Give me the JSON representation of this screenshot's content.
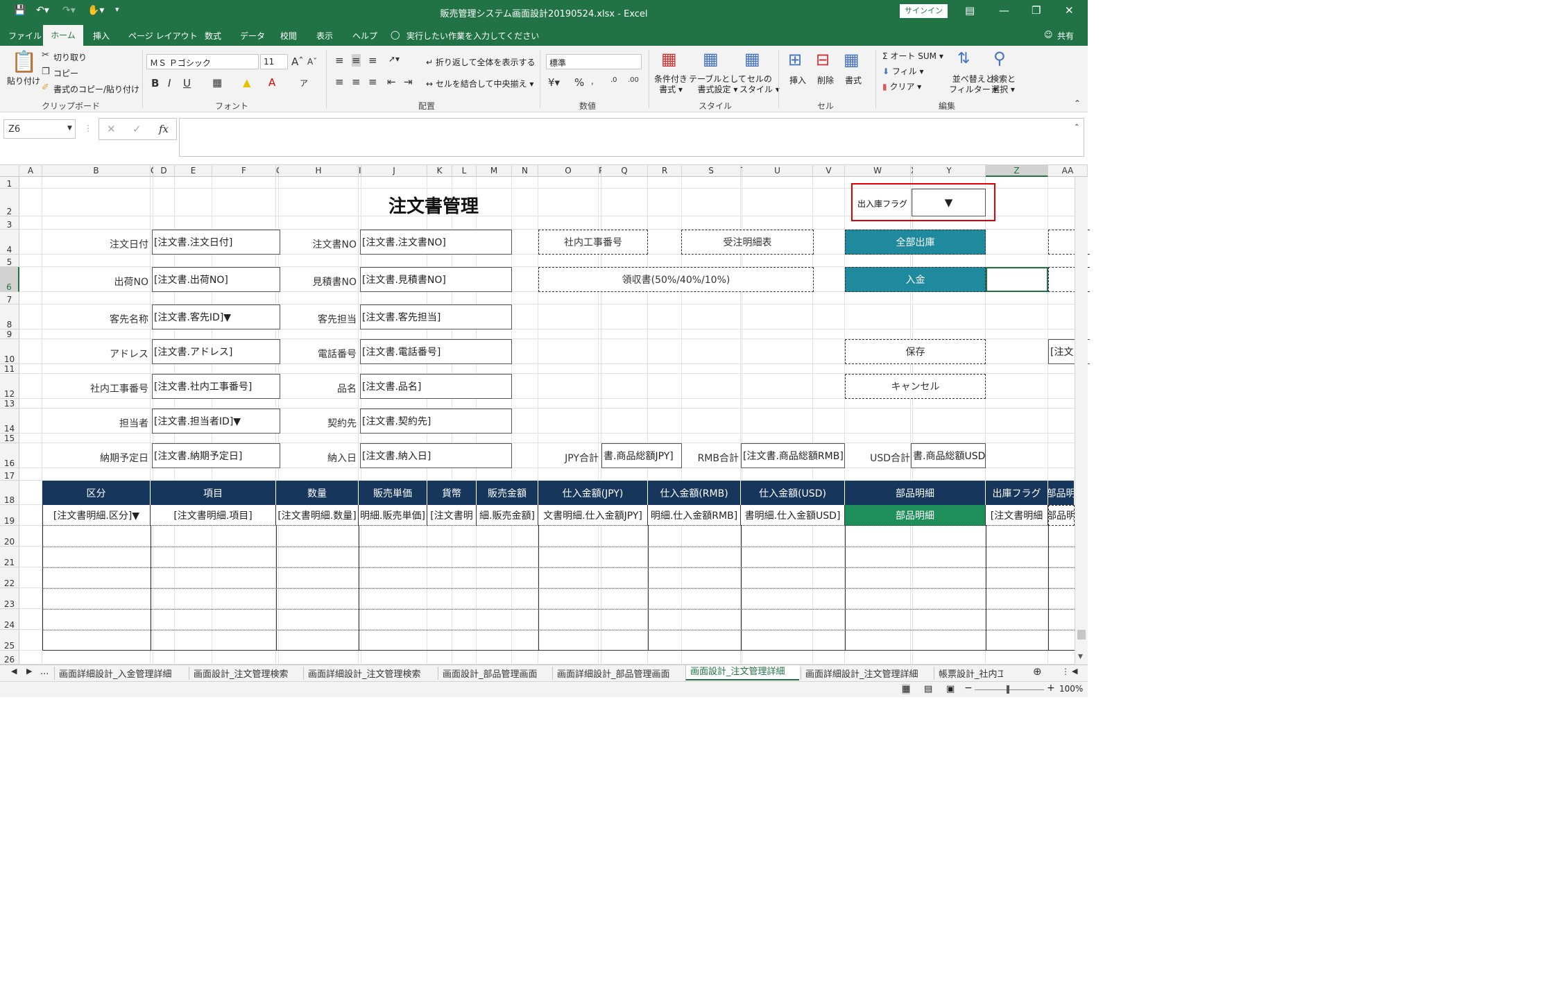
{
  "titlebar": {
    "filename": "販売管理システム画面設計20190524.xlsx",
    "app": "Excel",
    "sep": "-",
    "signin": "サインイン"
  },
  "menu": {
    "file": "ファイル",
    "home": "ホーム",
    "insert": "挿入",
    "layout": "ページ レイアウト",
    "formula": "数式",
    "data": "データ",
    "review": "校閲",
    "view": "表示",
    "help": "ヘルプ",
    "tellme": "実行したい作業を入力してください",
    "share": "共有"
  },
  "ribbon": {
    "paste": "貼り付け",
    "cut": "切り取り",
    "copy": "コピー",
    "format_painter": "書式のコピー/貼り付け",
    "clipboard": "クリップボード",
    "font_name": "ＭＳ Ｐゴシック",
    "font_size": "11",
    "font_group": "フォント",
    "wrap": "折り返して全体を表示する",
    "merge": "セルを結合して中央揃え",
    "align_group": "配置",
    "number_format": "標準",
    "number_group": "数値",
    "cond_format": "条件付き",
    "cond_format2": "書式",
    "table_format": "テーブルとして",
    "table_format2": "書式設定",
    "cell_style": "セルの",
    "cell_style2": "スタイル",
    "style_group": "スタイル",
    "insert": "挿入",
    "delete": "削除",
    "format": "書式",
    "cells_group": "セル",
    "autosum": "オート SUM",
    "fill": "フィル",
    "clear": "クリア",
    "sort": "並べ替えと",
    "sort2": "フィルター",
    "find": "検索と",
    "find2": "選択",
    "edit_group": "編集"
  },
  "formula_bar": {
    "namebox": "Z6",
    "fx": "fx",
    "value": ""
  },
  "columns": [
    "A",
    "B",
    "C",
    "D",
    "E",
    "F",
    "G",
    "H",
    "I",
    "J",
    "K",
    "L",
    "M",
    "N",
    "O",
    "P",
    "Q",
    "R",
    "S",
    "T",
    "U",
    "V",
    "W",
    "X",
    "Y",
    "Z",
    "AA"
  ],
  "rows": [
    "1",
    "2",
    "3",
    "4",
    "5",
    "6",
    "7",
    "8",
    "9",
    "10",
    "11",
    "12",
    "13",
    "14",
    "15",
    "16",
    "17",
    "18",
    "19",
    "20",
    "21",
    "22",
    "23",
    "24",
    "25",
    "26"
  ],
  "sheet": {
    "title": "注文書管理",
    "flag_label": "出入庫フラグ",
    "flag_value": "▼",
    "fields": [
      {
        "label": "注文日付",
        "value": "[注文書.注文日付]"
      },
      {
        "label": "注文書NO",
        "value": "[注文書.注文書NO]"
      },
      {
        "label": "出荷NO",
        "value": "[注文書.出荷NO]"
      },
      {
        "label": "見積書NO",
        "value": "[注文書.見積書NO]"
      },
      {
        "label": "客先名称",
        "value": "[注文書.客先ID]▼"
      },
      {
        "label": "客先担当",
        "value": "[注文書.客先担当]"
      },
      {
        "label": "アドレス",
        "value": "[注文書.アドレス]"
      },
      {
        "label": "電話番号",
        "value": "[注文書.電話番号]"
      },
      {
        "label": "社内工事番号",
        "value": "[注文書.社内工事番号]"
      },
      {
        "label": "品名",
        "value": "[注文書.品名]"
      },
      {
        "label": "担当者",
        "value": "[注文書.担当者ID]▼"
      },
      {
        "label": "契約先",
        "value": "[注文書.契約先]"
      },
      {
        "label": "納期予定日",
        "value": "[注文書.納期予定日]"
      },
      {
        "label": "納入日",
        "value": "[注文書.納入日]"
      }
    ],
    "btn_koji": "社内工事番号",
    "btn_juchu": "受注明細表",
    "btn_ryoshu": "領収書(50%/40%/10%)",
    "btn_all_out": "全部出庫",
    "btn_nyukin": "入金",
    "btn_save": "保存",
    "btn_cancel": "キャンセル",
    "aa10": "[注文",
    "jpy_label": "JPY合計",
    "jpy_value": "書.商品総額JPY]",
    "rmb_label": "RMB合計",
    "rmb_value": "[注文書.商品総額RMB]",
    "usd_label": "USD合計",
    "usd_value": "書.商品総額USD]",
    "table_headers": [
      "区分",
      "項目",
      "数量",
      "販売単価",
      "貨幣",
      "販売金額",
      "仕入金額(JPY)",
      "仕入金額(RMB)",
      "仕入金額(USD)",
      "部品明細",
      "出庫フラグ",
      "部品明"
    ],
    "table_row": [
      "[注文書明細.区分]▼",
      "[注文書明細.項目]",
      "[注文書明細.数量]",
      "明細.販売単価]",
      "[注文書明",
      "細.販売金額]",
      "文書明細.仕入金額JPY]",
      "明細.仕入金額RMB]",
      "書明細.仕入金額USD]",
      "部品明細",
      "[注文書明細",
      "部品明"
    ]
  },
  "sheet_tabs": [
    "画面詳細設計_入金管理詳細",
    "画面設計_注文管理検索",
    "画面詳細設計_注文管理検索",
    "画面設計_部品管理画面",
    "画面詳細設計_部品管理画面",
    "画面設計_注文管理詳細",
    "画面詳細設計_注文管理詳細",
    "帳票設計_社内工"
  ],
  "status": {
    "zoom": "100%"
  }
}
